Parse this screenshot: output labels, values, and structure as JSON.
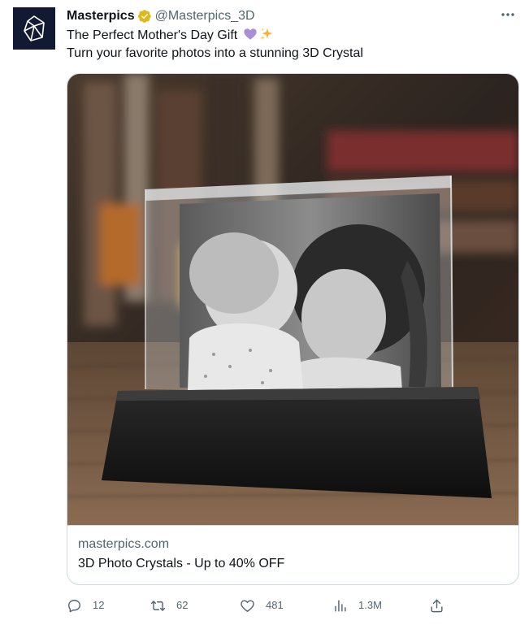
{
  "tweet": {
    "author_name": "Masterpics",
    "author_handle": "@Masterpics_3D",
    "text_line1": "The Perfect Mother's Day Gift",
    "text_line2": "Turn your favorite photos into a stunning 3D Crystal"
  },
  "card": {
    "domain": "masterpics.com",
    "title": "3D Photo Crystals - Up to 40% OFF"
  },
  "actions": {
    "reply_count": "12",
    "retweet_count": "62",
    "like_count": "481",
    "views_count": "1.3M"
  },
  "icons": {
    "avatar": "crystal-logo-icon",
    "verified": "verified-badge-icon",
    "more": "more-options-icon",
    "emoji1": "purple-heart-icon",
    "emoji2": "sparkles-icon",
    "reply": "reply-icon",
    "retweet": "retweet-icon",
    "like": "like-icon",
    "views": "views-icon",
    "share": "share-icon"
  },
  "colors": {
    "text_primary": "#0f1419",
    "text_secondary": "#536471",
    "border": "#cfd9de",
    "verified_gold": "#e2b719",
    "avatar_bg": "#121a33"
  }
}
